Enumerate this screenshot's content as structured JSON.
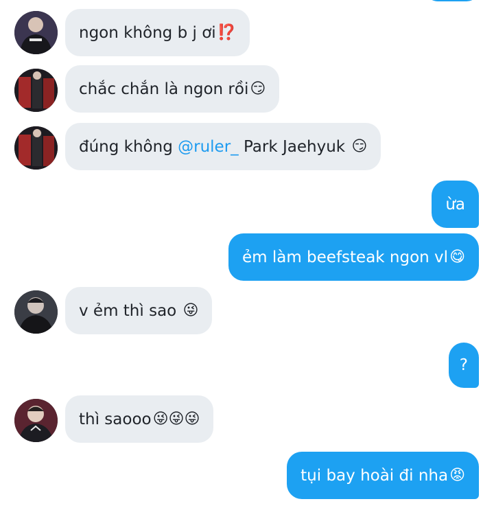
{
  "messages": [
    {
      "text": "ngon không b j ơi",
      "emoji": "⁉️"
    },
    {
      "text": "chắc chắn là ngon rồi",
      "emoji": "😏"
    },
    {
      "text_before": "đúng không ",
      "mention": "@ruler_",
      "text_after": " Park Jaehyuk ",
      "emoji": "😏"
    },
    {
      "text": "ừa"
    },
    {
      "text": "ẻm làm beefsteak ngon vl",
      "emoji": "😋"
    },
    {
      "text": "v ẻm thì sao ",
      "emoji": "😜"
    },
    {
      "text": "?"
    },
    {
      "text": "thì saooo",
      "emoji": "😜😜😜"
    },
    {
      "text": "tụi bay hoài đi nha",
      "emoji": "😡"
    }
  ],
  "colors": {
    "outgoing": "#1da1f2",
    "incoming": "#e9edf1",
    "mention": "#1d9bf0"
  }
}
